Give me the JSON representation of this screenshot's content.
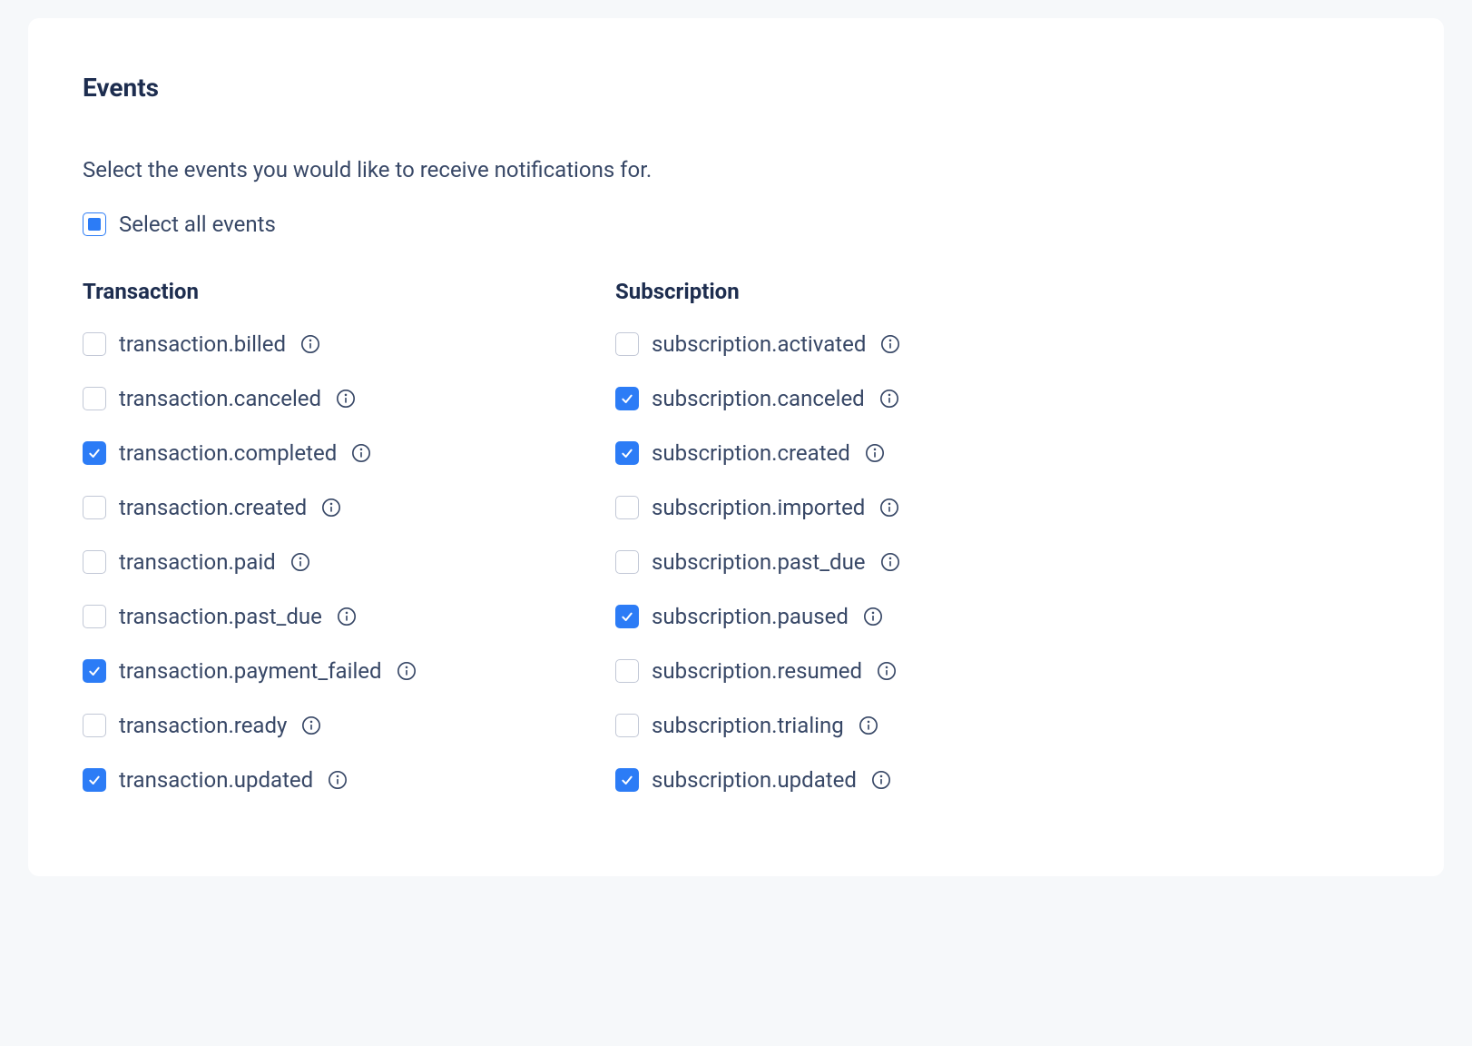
{
  "title": "Events",
  "description": "Select the events you would like to receive notifications for.",
  "select_all_label": "Select all events",
  "select_all_state": "indeterminate",
  "groups": [
    {
      "title": "Transaction",
      "events": [
        {
          "label": "transaction.billed",
          "checked": false
        },
        {
          "label": "transaction.canceled",
          "checked": false
        },
        {
          "label": "transaction.completed",
          "checked": true
        },
        {
          "label": "transaction.created",
          "checked": false
        },
        {
          "label": "transaction.paid",
          "checked": false
        },
        {
          "label": "transaction.past_due",
          "checked": false
        },
        {
          "label": "transaction.payment_failed",
          "checked": true
        },
        {
          "label": "transaction.ready",
          "checked": false
        },
        {
          "label": "transaction.updated",
          "checked": true
        }
      ]
    },
    {
      "title": "Subscription",
      "events": [
        {
          "label": "subscription.activated",
          "checked": false
        },
        {
          "label": "subscription.canceled",
          "checked": true
        },
        {
          "label": "subscription.created",
          "checked": true
        },
        {
          "label": "subscription.imported",
          "checked": false
        },
        {
          "label": "subscription.past_due",
          "checked": false
        },
        {
          "label": "subscription.paused",
          "checked": true
        },
        {
          "label": "subscription.resumed",
          "checked": false
        },
        {
          "label": "subscription.trialing",
          "checked": false
        },
        {
          "label": "subscription.updated",
          "checked": true
        }
      ]
    }
  ]
}
